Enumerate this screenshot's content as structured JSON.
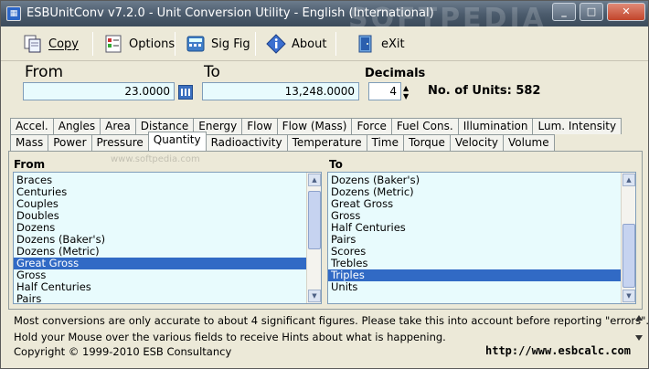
{
  "window": {
    "title": "ESBUnitConv v7.2.0 - Unit Conversion Utility - English (International)",
    "watermark": "SOFTPEDIA",
    "small_watermark": "www.softpedia.com",
    "min_label": "_",
    "max_label": "□",
    "close_label": "✕"
  },
  "toolbar": {
    "copy_label": "Copy",
    "options_label": "Options",
    "sigfig_label": "Sig Fig",
    "about_label": "About",
    "exit_label": "eXit"
  },
  "conversion": {
    "from_label": "From",
    "to_label": "To",
    "from_value": "23.0000",
    "to_value": "13,248.0000",
    "decimals_label": "Decimals",
    "decimals_value": "4",
    "units_count": "No. of Units: 582"
  },
  "tabs": {
    "row1": [
      "Accel.",
      "Angles",
      "Area",
      "Distance",
      "Energy",
      "Flow",
      "Flow (Mass)",
      "Force",
      "Fuel Cons.",
      "Illumination",
      "Lum. Intensity"
    ],
    "row2": [
      "Mass",
      "Power",
      "Pressure",
      "Quantity",
      "Radioactivity",
      "Temperature",
      "Time",
      "Torque",
      "Velocity",
      "Volume"
    ],
    "active": "Quantity"
  },
  "from_list": {
    "title": "From",
    "items": [
      "Braces",
      "Centuries",
      "Couples",
      "Doubles",
      "Dozens",
      "Dozens (Baker's)",
      "Dozens (Metric)",
      "Great Gross",
      "Gross",
      "Half Centuries",
      "Pairs"
    ],
    "selected": "Great Gross"
  },
  "to_list": {
    "title": "To",
    "items": [
      "Dozens (Baker's)",
      "Dozens (Metric)",
      "Great Gross",
      "Gross",
      "Half Centuries",
      "Pairs",
      "Scores",
      "Trebles",
      "Triples",
      "Units"
    ],
    "selected": "Triples"
  },
  "footer": {
    "hint1": "Most conversions are only accurate to about 4 significant figures. Please take this into account before reporting \"errors\".",
    "hint2": "Hold your Mouse over the various fields to receive Hints about what is happening.",
    "copyright": "Copyright © 1999-2010 ESB Consultancy",
    "website": "http://www.esbcalc.com"
  },
  "colors": {
    "field_bg": "#e8fbfd",
    "selection": "#316ac5",
    "window_bg": "#ECE9D8"
  }
}
